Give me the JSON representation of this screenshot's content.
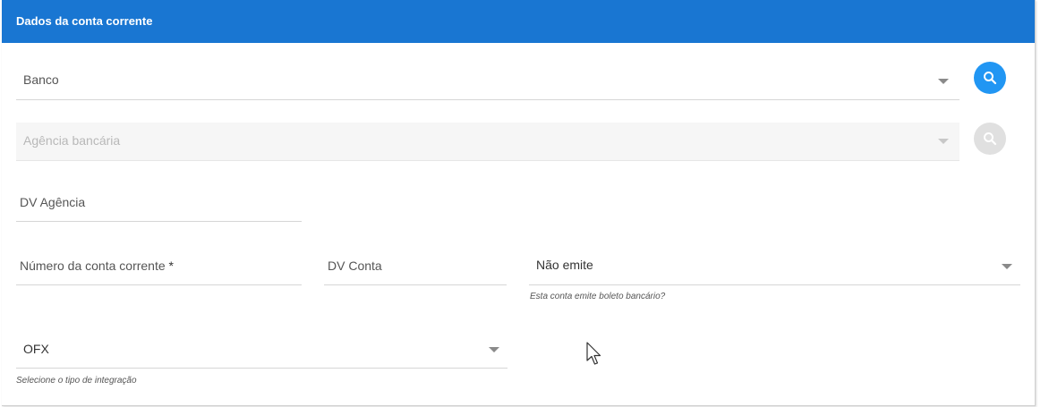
{
  "header": {
    "title": "Dados da conta corrente"
  },
  "fields": {
    "banco": {
      "label": "Banco"
    },
    "agencia": {
      "label": "Agência bancária"
    },
    "dv_agencia": {
      "label": "DV Agência"
    },
    "numero_conta": {
      "label": "Número da conta corrente",
      "required_mark": "*"
    },
    "dv_conta": {
      "label": "DV Conta"
    },
    "boleto": {
      "value": "Não emite",
      "hint": "Esta conta emite boleto bancário?"
    },
    "integracao": {
      "value": "OFX",
      "hint": "Selecione o tipo de integração"
    }
  },
  "colors": {
    "header": "#1976d2",
    "search_button": "#2196f3",
    "search_button_disabled": "#e0e0e0"
  },
  "icons": {
    "search": "search-icon",
    "dropdown": "chevron-down-icon",
    "cursor": "mouse-pointer-icon"
  }
}
